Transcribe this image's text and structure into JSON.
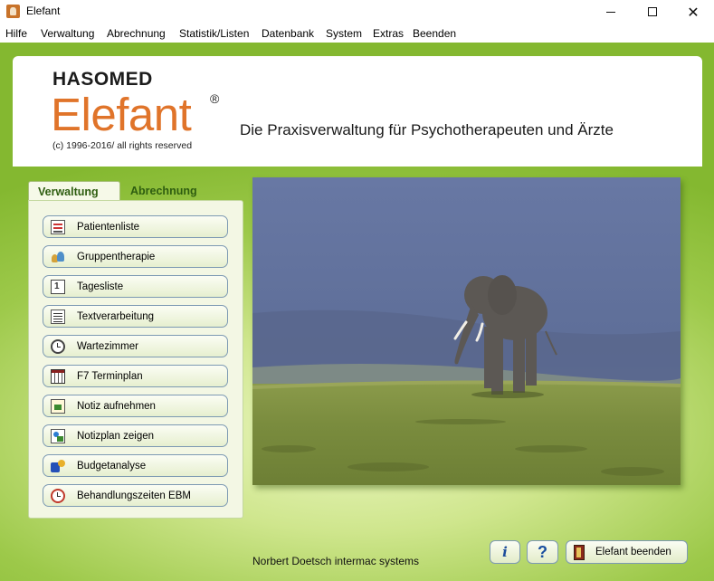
{
  "window": {
    "title": "Elefant",
    "app_icon": "elefant-app-icon",
    "minimize_glyph": "",
    "close_glyph": "✕"
  },
  "menu": [
    {
      "label": "Hilfe"
    },
    {
      "label": "Verwaltung"
    },
    {
      "label": "Abrechnung"
    },
    {
      "label": "Statistik/Listen"
    },
    {
      "label": "Datenbank"
    },
    {
      "label": "System"
    },
    {
      "label": "Extras"
    },
    {
      "label": "Beenden"
    }
  ],
  "header": {
    "company": "HASOMED",
    "product": "Elefant",
    "registered": "®",
    "copyright": "(c) 1996-2016/ all rights reserved",
    "tagline": "Die Praxisverwaltung für Psychotherapeuten und Ärzte"
  },
  "tabs": {
    "active": "Verwaltung",
    "inactive": "Abrechnung"
  },
  "nav_buttons": [
    {
      "label": "Patientenliste",
      "icon": "patient-list-icon"
    },
    {
      "label": "Gruppentherapie",
      "icon": "group-therapy-icon"
    },
    {
      "label": "Tagesliste",
      "icon": "day-list-icon"
    },
    {
      "label": "Textverarbeitung",
      "icon": "word-processing-icon"
    },
    {
      "label": "Wartezimmer",
      "icon": "waiting-room-clock-icon"
    },
    {
      "label": "F7 Terminplan",
      "icon": "calendar-icon"
    },
    {
      "label": "Notiz aufnehmen",
      "icon": "note-icon"
    },
    {
      "label": "Notizplan zeigen",
      "icon": "note-plan-icon"
    },
    {
      "label": "Budgetanalyse",
      "icon": "budget-icon"
    },
    {
      "label": "Behandlungszeiten EBM",
      "icon": "treatment-time-icon"
    }
  ],
  "photo": {
    "subject": "elephant-on-savanna"
  },
  "footer": {
    "credit": "Norbert Doetsch intermac systems",
    "info_glyph": "i",
    "help_glyph": "?",
    "exit_label": "Elefant beenden"
  },
  "colors": {
    "brand_orange": "#e0742a",
    "tab_green": "#2e5d10",
    "background_green": "#9dc94a"
  }
}
